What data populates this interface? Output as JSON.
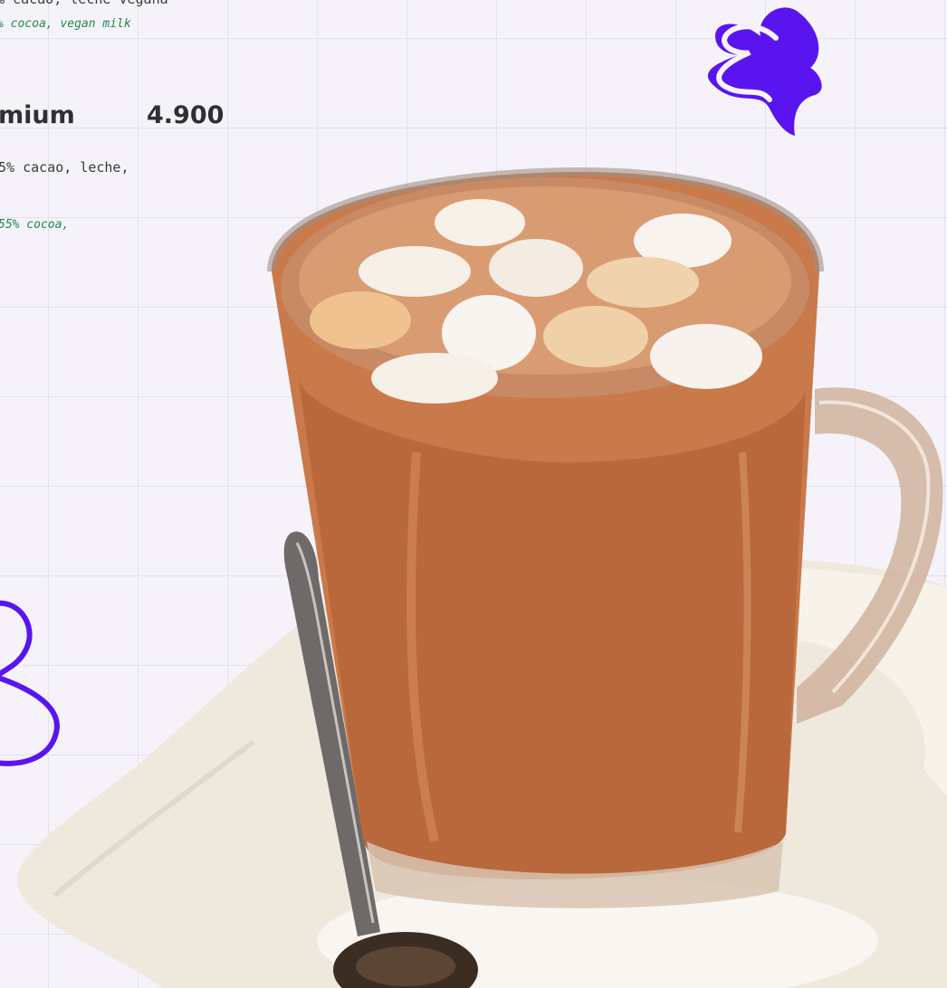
{
  "menu": {
    "item_prev": {
      "desc_es": "% cacao, leche vegana",
      "desc_en": "% cocoa, vegan milk"
    },
    "item_premium": {
      "name": "mium",
      "price": "4.900",
      "desc_es": "5% cacao, leche,",
      "desc_en": "55% cocoa,"
    }
  },
  "colors": {
    "accent_purple": "#5a14f0",
    "grid_line": "#e3e1ea",
    "background": "#f5f3f9",
    "english_text": "#1f8a4c"
  },
  "icons": [
    "blob-squiggle-top",
    "blob-squiggle-left"
  ]
}
